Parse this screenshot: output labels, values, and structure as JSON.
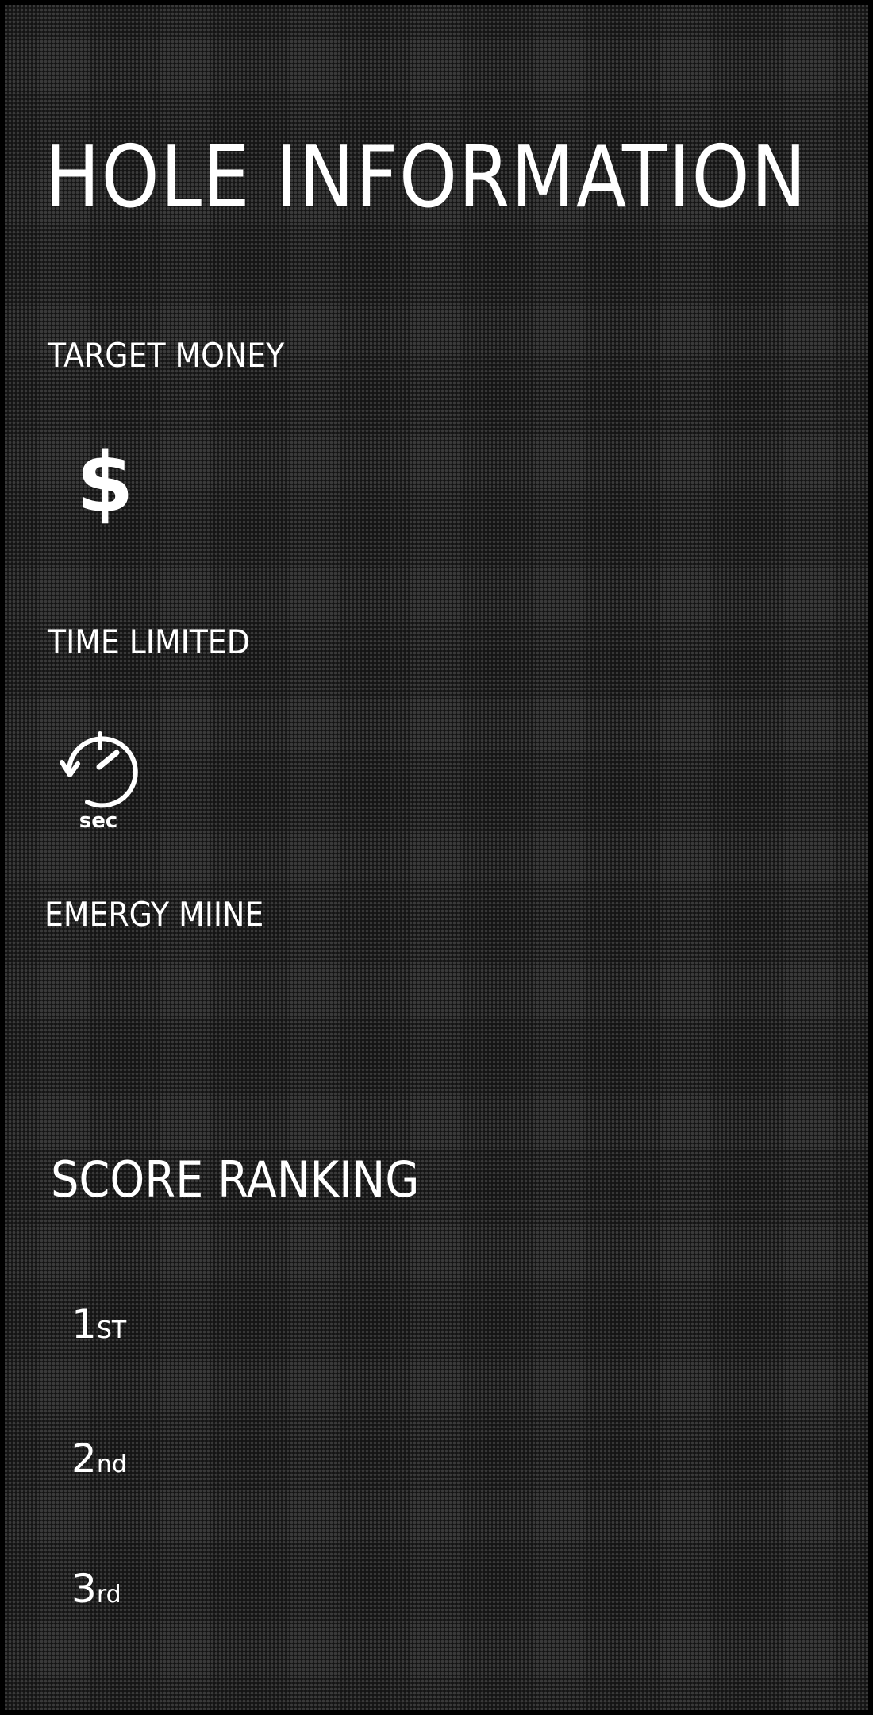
{
  "panel": {
    "title": "HOLE INFORMATION"
  },
  "sections": {
    "target_money": {
      "label": "TARGET MONEY",
      "icon": "dollar-icon",
      "symbol": "$"
    },
    "time_limited": {
      "label": "TIME LIMITED",
      "icon": "timer-icon",
      "unit": "sec"
    },
    "emergy_mine": {
      "label": "EMERGY MIINE"
    }
  },
  "score_ranking": {
    "title": "SCORE RANKING",
    "ranks": [
      {
        "number": "1",
        "suffix": "ST"
      },
      {
        "number": "2",
        "suffix": "nd"
      },
      {
        "number": "3",
        "suffix": "rd"
      }
    ]
  },
  "colors": {
    "background": "#141414",
    "dot": "#3a3a3a",
    "text": "#ffffff"
  }
}
